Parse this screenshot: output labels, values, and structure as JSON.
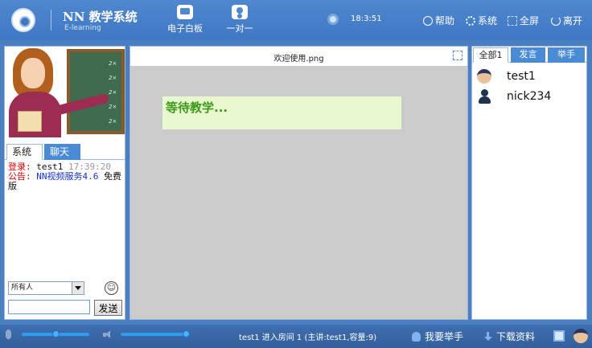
{
  "header": {
    "app_title": "NN 教学系统",
    "app_subtitle": "E-learning",
    "modes": [
      {
        "label": "电子白板",
        "icon": "whiteboard-icon"
      },
      {
        "label": "一对一",
        "icon": "one-on-one-icon"
      }
    ],
    "clock": "18:3:51",
    "buttons": {
      "help": "帮助",
      "system": "系统",
      "fullscreen": "全屏",
      "leave": "离开"
    },
    "colors": {
      "background": "#4f88cf",
      "text": "#ffffff"
    }
  },
  "left_panel": {
    "tabs": [
      "系统",
      "聊天"
    ],
    "messages": {
      "login_label": "登录:",
      "login_user": "test1",
      "login_time": "17:39:20",
      "notice_label": "公告:",
      "notice_text": "NN视频服务4.6",
      "notice_suffix": "免费版"
    },
    "chalkboard_lines": [
      "2×",
      "2×",
      "2×",
      "2×",
      "2×"
    ],
    "recipient_select": "所有人",
    "chat_input_value": "",
    "send_label": "发送"
  },
  "center_panel": {
    "doc_title": "欢迎使用.png",
    "waiting_text": "等待教学..."
  },
  "right_panel": {
    "tabs": [
      "全部1",
      "发言",
      "举手"
    ],
    "users": [
      {
        "name": "test1",
        "icon": "teacher-avatar-icon"
      },
      {
        "name": "nick234",
        "icon": "student-avatar-icon"
      }
    ]
  },
  "footer": {
    "status_text": "test1 进入房间 1 (主讲:test1,容量:9)",
    "raise_hand_label": "我要举手",
    "download_label": "下载资料",
    "mic_level": 0.5,
    "speaker_level": 1.0
  }
}
